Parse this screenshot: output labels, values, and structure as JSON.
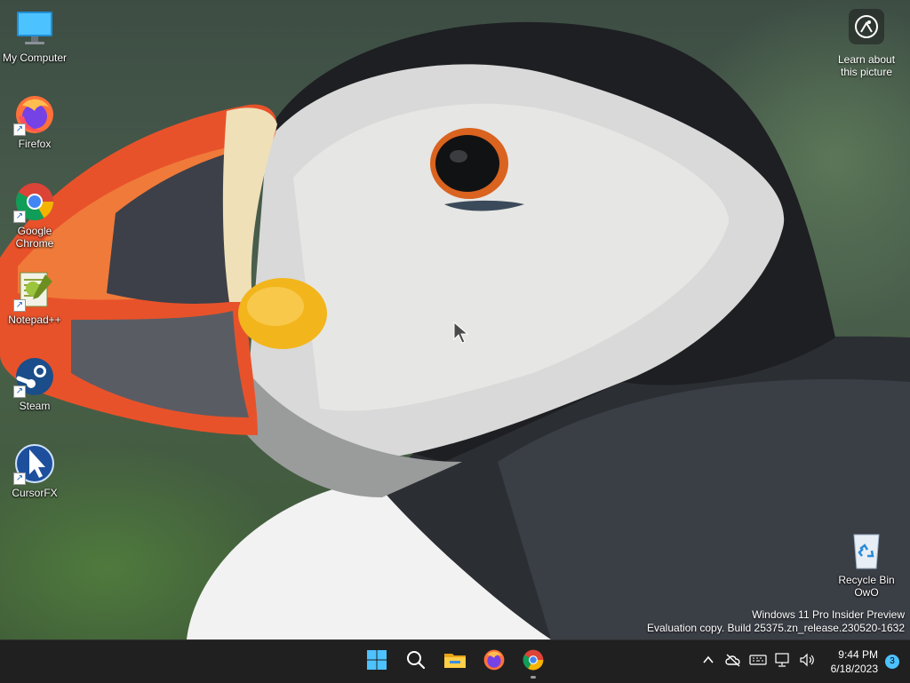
{
  "desktop": {
    "icons": [
      {
        "label": "My Computer",
        "icon": "monitor-icon"
      },
      {
        "label": "Firefox",
        "icon": "firefox-icon"
      },
      {
        "label": "Google Chrome",
        "icon": "chrome-icon"
      },
      {
        "label": "Notepad++",
        "icon": "notepadpp-icon"
      },
      {
        "label": "Steam",
        "icon": "steam-icon"
      },
      {
        "label": "CursorFX",
        "icon": "cursorfx-icon"
      }
    ],
    "recycle_bin": {
      "label": "Recycle Bin OwO",
      "icon": "recycle-bin-icon"
    },
    "learn_picture": {
      "label": "Learn about this picture",
      "icon": "camera-lens-icon"
    },
    "watermark": {
      "line1": "Windows 11 Pro Insider Preview",
      "line2": "Evaluation copy. Build 25375.zn_release.230520-1632"
    }
  },
  "taskbar": {
    "apps": [
      {
        "name": "Start",
        "icon": "windows-start-icon"
      },
      {
        "name": "Search",
        "icon": "search-icon"
      },
      {
        "name": "File Explorer",
        "icon": "folder-icon"
      },
      {
        "name": "Firefox",
        "icon": "firefox-icon"
      },
      {
        "name": "Google Chrome",
        "icon": "chrome-icon"
      }
    ],
    "tray": {
      "time": "9:44 PM",
      "date": "6/18/2023",
      "notification_count": "3"
    }
  },
  "colors": {
    "taskbar": "#202020",
    "accent": "#4cc2ff",
    "puffin_beak_orange": "#e8522a",
    "puffin_beak_yellow": "#f2b51c"
  }
}
